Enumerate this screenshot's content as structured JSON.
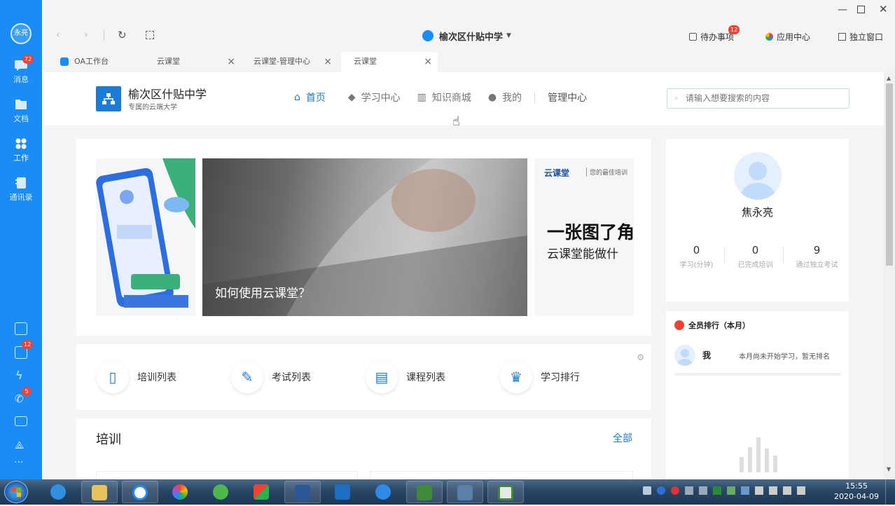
{
  "sidebar": {
    "avatar": "永亮",
    "items": [
      {
        "label": "消息",
        "badge": "72"
      },
      {
        "label": "文档"
      },
      {
        "label": "工作"
      },
      {
        "label": "通讯录"
      }
    ],
    "bottom_badges": {
      "tasks": "12",
      "phone": "5"
    },
    "more": "···"
  },
  "topbar": {
    "org_name": "榆次区什贴中学",
    "todo_label": "待办事项",
    "todo_badge": "12",
    "app_center": "应用中心",
    "standalone": "独立窗口"
  },
  "tabs": [
    {
      "label": "OA工作台"
    },
    {
      "label": "云课堂"
    },
    {
      "label": "云课堂-管理中心"
    },
    {
      "label": "云课堂"
    }
  ],
  "site": {
    "school_name": "榆次区什贴中学",
    "school_sub": "专属的云端大学",
    "nav": [
      "首页",
      "学习中心",
      "知识商城",
      "我的",
      "管理中心"
    ],
    "search_placeholder": "请输入想要搜索的内容"
  },
  "banner": {
    "caption": "如何使用云课堂？",
    "right_brand": "云课堂",
    "right_tagline": "您的最佳培训",
    "right_title": "一张图了角",
    "right_sub": "云课堂能做什"
  },
  "quick_links": [
    "培训列表",
    "考试列表",
    "课程列表",
    "学习排行"
  ],
  "training": {
    "title": "培训",
    "all": "全部"
  },
  "profile": {
    "name": "焦永亮",
    "stats": [
      {
        "value": "0",
        "label": "学习(分钟)"
      },
      {
        "value": "0",
        "label": "已完成培训"
      },
      {
        "value": "9",
        "label": "通过独立考试"
      }
    ]
  },
  "ranking": {
    "title": "全员排行（本月）",
    "me": "我",
    "note": "本月尚未开始学习，暂无排名"
  },
  "clock": {
    "time": "15:55",
    "date": "2020-04-09"
  },
  "colors": {
    "sidebar": "#1a8cf5",
    "accent": "#1a7bd8",
    "badge": "#f04134"
  }
}
